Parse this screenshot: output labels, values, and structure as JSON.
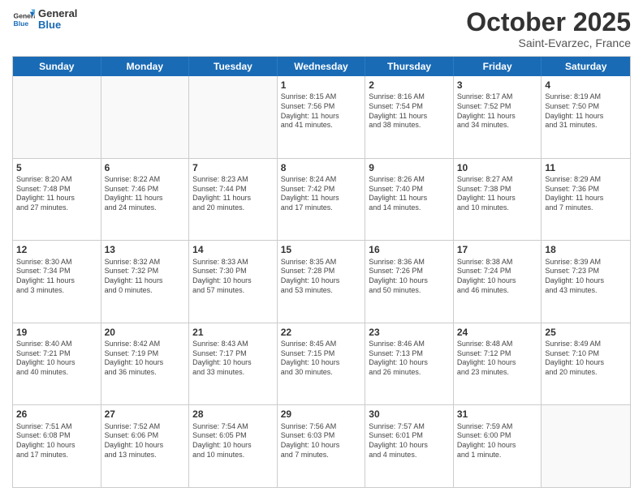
{
  "logo": {
    "line1": "General",
    "line2": "Blue"
  },
  "title": "October 2025",
  "location": "Saint-Evarzec, France",
  "header_days": [
    "Sunday",
    "Monday",
    "Tuesday",
    "Wednesday",
    "Thursday",
    "Friday",
    "Saturday"
  ],
  "weeks": [
    [
      {
        "day": "",
        "info": ""
      },
      {
        "day": "",
        "info": ""
      },
      {
        "day": "",
        "info": ""
      },
      {
        "day": "1",
        "info": "Sunrise: 8:15 AM\nSunset: 7:56 PM\nDaylight: 11 hours\nand 41 minutes."
      },
      {
        "day": "2",
        "info": "Sunrise: 8:16 AM\nSunset: 7:54 PM\nDaylight: 11 hours\nand 38 minutes."
      },
      {
        "day": "3",
        "info": "Sunrise: 8:17 AM\nSunset: 7:52 PM\nDaylight: 11 hours\nand 34 minutes."
      },
      {
        "day": "4",
        "info": "Sunrise: 8:19 AM\nSunset: 7:50 PM\nDaylight: 11 hours\nand 31 minutes."
      }
    ],
    [
      {
        "day": "5",
        "info": "Sunrise: 8:20 AM\nSunset: 7:48 PM\nDaylight: 11 hours\nand 27 minutes."
      },
      {
        "day": "6",
        "info": "Sunrise: 8:22 AM\nSunset: 7:46 PM\nDaylight: 11 hours\nand 24 minutes."
      },
      {
        "day": "7",
        "info": "Sunrise: 8:23 AM\nSunset: 7:44 PM\nDaylight: 11 hours\nand 20 minutes."
      },
      {
        "day": "8",
        "info": "Sunrise: 8:24 AM\nSunset: 7:42 PM\nDaylight: 11 hours\nand 17 minutes."
      },
      {
        "day": "9",
        "info": "Sunrise: 8:26 AM\nSunset: 7:40 PM\nDaylight: 11 hours\nand 14 minutes."
      },
      {
        "day": "10",
        "info": "Sunrise: 8:27 AM\nSunset: 7:38 PM\nDaylight: 11 hours\nand 10 minutes."
      },
      {
        "day": "11",
        "info": "Sunrise: 8:29 AM\nSunset: 7:36 PM\nDaylight: 11 hours\nand 7 minutes."
      }
    ],
    [
      {
        "day": "12",
        "info": "Sunrise: 8:30 AM\nSunset: 7:34 PM\nDaylight: 11 hours\nand 3 minutes."
      },
      {
        "day": "13",
        "info": "Sunrise: 8:32 AM\nSunset: 7:32 PM\nDaylight: 11 hours\nand 0 minutes."
      },
      {
        "day": "14",
        "info": "Sunrise: 8:33 AM\nSunset: 7:30 PM\nDaylight: 10 hours\nand 57 minutes."
      },
      {
        "day": "15",
        "info": "Sunrise: 8:35 AM\nSunset: 7:28 PM\nDaylight: 10 hours\nand 53 minutes."
      },
      {
        "day": "16",
        "info": "Sunrise: 8:36 AM\nSunset: 7:26 PM\nDaylight: 10 hours\nand 50 minutes."
      },
      {
        "day": "17",
        "info": "Sunrise: 8:38 AM\nSunset: 7:24 PM\nDaylight: 10 hours\nand 46 minutes."
      },
      {
        "day": "18",
        "info": "Sunrise: 8:39 AM\nSunset: 7:23 PM\nDaylight: 10 hours\nand 43 minutes."
      }
    ],
    [
      {
        "day": "19",
        "info": "Sunrise: 8:40 AM\nSunset: 7:21 PM\nDaylight: 10 hours\nand 40 minutes."
      },
      {
        "day": "20",
        "info": "Sunrise: 8:42 AM\nSunset: 7:19 PM\nDaylight: 10 hours\nand 36 minutes."
      },
      {
        "day": "21",
        "info": "Sunrise: 8:43 AM\nSunset: 7:17 PM\nDaylight: 10 hours\nand 33 minutes."
      },
      {
        "day": "22",
        "info": "Sunrise: 8:45 AM\nSunset: 7:15 PM\nDaylight: 10 hours\nand 30 minutes."
      },
      {
        "day": "23",
        "info": "Sunrise: 8:46 AM\nSunset: 7:13 PM\nDaylight: 10 hours\nand 26 minutes."
      },
      {
        "day": "24",
        "info": "Sunrise: 8:48 AM\nSunset: 7:12 PM\nDaylight: 10 hours\nand 23 minutes."
      },
      {
        "day": "25",
        "info": "Sunrise: 8:49 AM\nSunset: 7:10 PM\nDaylight: 10 hours\nand 20 minutes."
      }
    ],
    [
      {
        "day": "26",
        "info": "Sunrise: 7:51 AM\nSunset: 6:08 PM\nDaylight: 10 hours\nand 17 minutes."
      },
      {
        "day": "27",
        "info": "Sunrise: 7:52 AM\nSunset: 6:06 PM\nDaylight: 10 hours\nand 13 minutes."
      },
      {
        "day": "28",
        "info": "Sunrise: 7:54 AM\nSunset: 6:05 PM\nDaylight: 10 hours\nand 10 minutes."
      },
      {
        "day": "29",
        "info": "Sunrise: 7:56 AM\nSunset: 6:03 PM\nDaylight: 10 hours\nand 7 minutes."
      },
      {
        "day": "30",
        "info": "Sunrise: 7:57 AM\nSunset: 6:01 PM\nDaylight: 10 hours\nand 4 minutes."
      },
      {
        "day": "31",
        "info": "Sunrise: 7:59 AM\nSunset: 6:00 PM\nDaylight: 10 hours\nand 1 minute."
      },
      {
        "day": "",
        "info": ""
      }
    ]
  ]
}
